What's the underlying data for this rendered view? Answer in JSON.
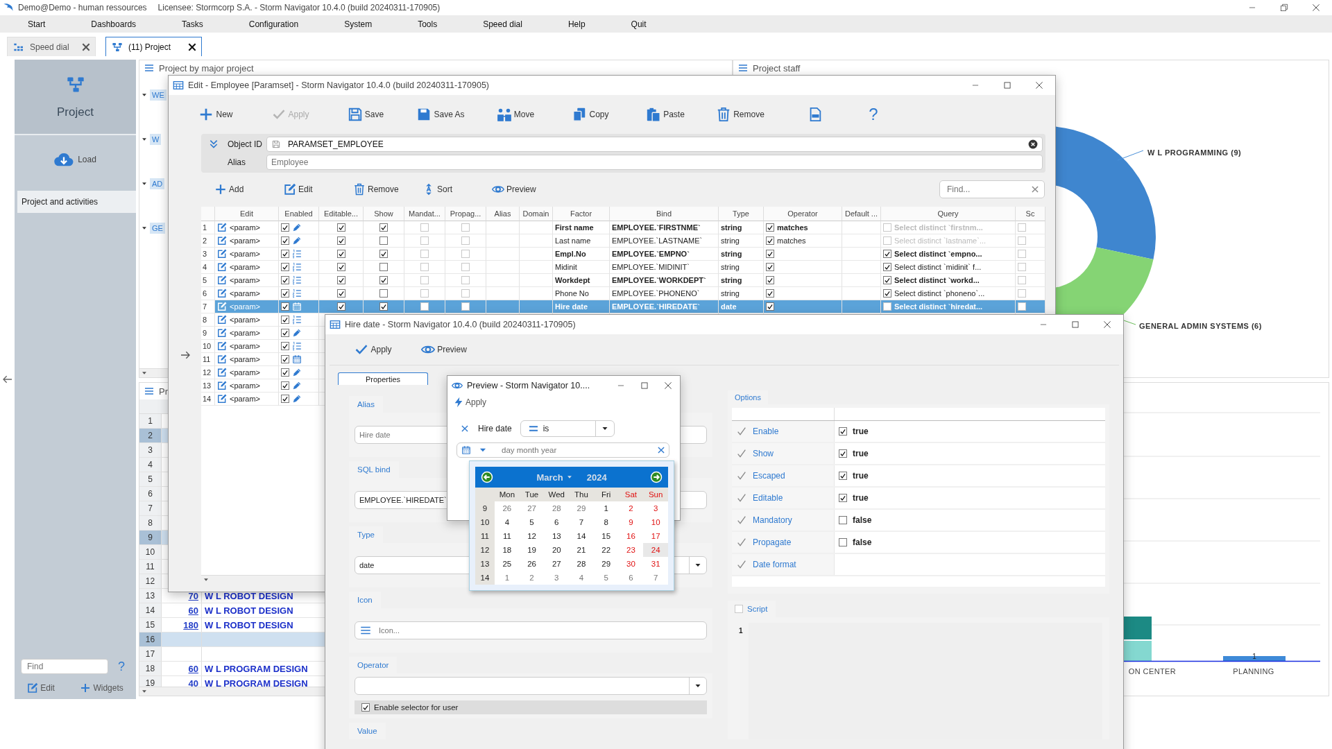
{
  "app_window": {
    "title": "Demo@Demo - human ressources",
    "subtitle": "Licensee: Stormcorp S.A. -  Storm Navigator 10.4.0 (build 20240311-170905)"
  },
  "menu": [
    "Start",
    "Dashboards",
    "Tasks",
    "Configuration",
    "System",
    "Tools",
    "Speed dial",
    "Help",
    "Quit"
  ],
  "tabs": [
    {
      "label": "Speed dial",
      "selected": false
    },
    {
      "label": "(11) Project",
      "selected": true
    }
  ],
  "sidebar": {
    "title": "Project",
    "load": "Load",
    "items": [
      {
        "label": "Project and activities",
        "selected": true
      }
    ],
    "find_placeholder": "Find",
    "help": "?",
    "edit": "Edit",
    "widgets": "Widgets"
  },
  "tree_panel": {
    "title": "Project by major project",
    "items": [
      "WE",
      "W",
      "AD",
      "GE"
    ]
  },
  "list_panel": {
    "title": "Pr",
    "rows": [
      {
        "n": "1",
        "selected": false
      },
      {
        "n": "2",
        "selected": true
      },
      {
        "n": "3",
        "selected": false
      },
      {
        "n": "4",
        "selected": false
      },
      {
        "n": "5",
        "selected": false
      },
      {
        "n": "6",
        "selected": false
      },
      {
        "n": "7",
        "selected": false
      },
      {
        "n": "8",
        "selected": false
      },
      {
        "n": "9",
        "selected": true
      },
      {
        "n": "10",
        "selected": false
      },
      {
        "n": "11",
        "selected": false
      },
      {
        "n": "12",
        "selected": false
      },
      {
        "n": "13",
        "value": "70",
        "name": "W L ROBOT DESIGN",
        "selected": false
      },
      {
        "n": "14",
        "value": "60",
        "name": "W L ROBOT DESIGN",
        "selected": false
      },
      {
        "n": "15",
        "value": "180",
        "name": "W L ROBOT DESIGN",
        "selected": false
      },
      {
        "n": "16",
        "selected": true
      },
      {
        "n": "17",
        "selected": false
      },
      {
        "n": "18",
        "value": "60",
        "name": "W L PROGRAM DESIGN",
        "selected": false
      },
      {
        "n": "19",
        "value": "40",
        "name": "W L PROGRAM DESIGN",
        "selected": false
      }
    ]
  },
  "staff_panel": {
    "title": "Project staff",
    "labels": [
      "W L PROGRAMMING (9)",
      "GENERAL ADMIN SYSTEMS (6)"
    ]
  },
  "bar_panel": {
    "categories": [
      "ON CENTER",
      "PLANNING"
    ],
    "value_label": "1"
  },
  "edit_window": {
    "title": "Edit - Employee [Paramset] -  Storm Navigator 10.4.0 (build 20240311-170905)",
    "toolbar": [
      {
        "kind": "new",
        "label": "New",
        "disabled": false
      },
      {
        "kind": "apply",
        "label": "Apply",
        "disabled": true
      },
      {
        "kind": "save",
        "label": "Save",
        "disabled": false
      },
      {
        "kind": "save-as",
        "label": "Save As",
        "disabled": false
      },
      {
        "kind": "move",
        "label": "Move",
        "disabled": false
      },
      {
        "kind": "copy",
        "label": "Copy",
        "disabled": false
      },
      {
        "kind": "paste",
        "label": "Paste",
        "disabled": false
      },
      {
        "kind": "remove",
        "label": "Remove",
        "disabled": false
      },
      {
        "kind": "xml",
        "disabled": false
      },
      {
        "kind": "help",
        "label": "?",
        "disabled": false
      }
    ],
    "object_id": {
      "label": "Object ID",
      "value": "PARAMSET_EMPLOYEE"
    },
    "alias": {
      "label": "Alias",
      "placeholder": "Employee"
    },
    "list_toolbar": [
      {
        "kind": "add",
        "label": "Add"
      },
      {
        "kind": "edit",
        "label": "Edit"
      },
      {
        "kind": "remove",
        "label": "Remove"
      },
      {
        "kind": "sort",
        "label": "Sort"
      },
      {
        "kind": "preview",
        "label": "Preview"
      }
    ],
    "find_placeholder": "Find...",
    "columns": [
      "Edit",
      "Enabled",
      "Editable...",
      "Show",
      "Mandat...",
      "Propag...",
      "Alias",
      "Domain",
      "Factor",
      "Bind",
      "Type",
      "Operator",
      "Default ...",
      "Query",
      "Sc"
    ],
    "rows": [
      {
        "n": "1",
        "edit": "<param>",
        "enabled": true,
        "kind": "pencil",
        "editable": true,
        "show": true,
        "mandatory": false,
        "propagate": false,
        "factor": "First name",
        "bind": "EMPLOYEE.`FIRSTNME`",
        "type": "string",
        "operator_on": true,
        "operator": "matches",
        "query_on": false,
        "query": "Select distinct `firstnm...",
        "sc": false,
        "selected": false
      },
      {
        "n": "2",
        "edit": "<param>",
        "enabled": true,
        "kind": "pencil",
        "editable": true,
        "show": false,
        "mandatory": false,
        "propagate": false,
        "factor": "Last name",
        "bind": "EMPLOYEE.`LASTNAME`",
        "type": "string",
        "operator_on": true,
        "operator": "matches",
        "query_on": false,
        "query": "Select distinct `lastname`...",
        "sc": false,
        "selected": false
      },
      {
        "n": "3",
        "edit": "<param>",
        "enabled": true,
        "kind": "list",
        "editable": true,
        "show": true,
        "mandatory": false,
        "propagate": false,
        "factor": "Empl.No",
        "bind": "EMPLOYEE.`EMPNO`",
        "type": "string",
        "operator_on": true,
        "query_on": true,
        "query": "Select distinct `empno...",
        "sc": false,
        "selected": false
      },
      {
        "n": "4",
        "edit": "<param>",
        "enabled": true,
        "kind": "list",
        "editable": true,
        "show": false,
        "mandatory": false,
        "propagate": false,
        "factor": "Midinit",
        "bind": "EMPLOYEE.`MIDINIT`",
        "type": "string",
        "operator_on": true,
        "query_on": true,
        "query": "Select distinct `midinit` f...",
        "sc": false,
        "selected": false
      },
      {
        "n": "5",
        "edit": "<param>",
        "enabled": true,
        "kind": "list",
        "editable": true,
        "show": true,
        "mandatory": false,
        "propagate": false,
        "factor": "Workdept",
        "bind": "EMPLOYEE.`WORKDEPT`",
        "type": "string",
        "operator_on": true,
        "query_on": true,
        "query": "Select distinct `workd...",
        "sc": false,
        "selected": false
      },
      {
        "n": "6",
        "edit": "<param>",
        "enabled": true,
        "kind": "list",
        "editable": true,
        "show": false,
        "mandatory": false,
        "propagate": false,
        "factor": "Phone No",
        "bind": "EMPLOYEE.`PHONENO`",
        "type": "string",
        "operator_on": true,
        "query_on": true,
        "query": "Select distinct `phoneno`...",
        "sc": false,
        "selected": false
      },
      {
        "n": "7",
        "edit": "<param>",
        "enabled": true,
        "kind": "calendar",
        "editable": true,
        "show": true,
        "mandatory": false,
        "propagate": false,
        "factor": "Hire date",
        "bind": "EMPLOYEE.`HIREDATE`",
        "type": "date",
        "operator_on": true,
        "query_on": false,
        "query": "Select distinct `hiredat...",
        "sc": false,
        "selected": true
      },
      {
        "n": "8",
        "edit": "<param>",
        "enabled": true,
        "kind": "list",
        "selected": false
      },
      {
        "n": "9",
        "edit": "<param>",
        "enabled": true,
        "kind": "pencil",
        "selected": false
      },
      {
        "n": "10",
        "edit": "<param>",
        "enabled": true,
        "kind": "list",
        "selected": false
      },
      {
        "n": "11",
        "edit": "<param>",
        "enabled": true,
        "kind": "calendar",
        "selected": false
      },
      {
        "n": "12",
        "edit": "<param>",
        "enabled": true,
        "kind": "pencil",
        "selected": false
      },
      {
        "n": "13",
        "edit": "<param>",
        "enabled": true,
        "kind": "pencil",
        "selected": false
      },
      {
        "n": "14",
        "edit": "<param>",
        "enabled": true,
        "kind": "pencil",
        "selected": false
      }
    ]
  },
  "hire_window": {
    "title": "Hire date -  Storm Navigator 10.4.0 (build 20240311-170905)",
    "toolbar": [
      {
        "kind": "apply",
        "label": "Apply"
      },
      {
        "kind": "preview",
        "label": "Preview"
      }
    ],
    "tabs": [
      {
        "label": "Properties",
        "selected": true
      }
    ],
    "fields": [
      {
        "label": "Alias",
        "kind": "text",
        "placeholder": "Hire date"
      },
      {
        "label": "SQL bind",
        "kind": "text",
        "value": "EMPLOYEE.`HIREDATE`"
      },
      {
        "label": "Type",
        "kind": "select",
        "value": "date"
      },
      {
        "label": "Icon",
        "kind": "icon",
        "placeholder": "Icon..."
      },
      {
        "label": "Operator",
        "kind": "select"
      }
    ],
    "enable_selector": {
      "label": "Enable selector for user",
      "checked": true
    },
    "value_label": "Value",
    "options": {
      "title": "Options",
      "rows": [
        {
          "label": "Enable",
          "kind": "bool",
          "checked": true,
          "value": "true"
        },
        {
          "label": "Show",
          "kind": "bool",
          "checked": true,
          "value": "true"
        },
        {
          "label": "Escaped",
          "kind": "bool",
          "checked": true,
          "value": "true"
        },
        {
          "label": "Editable",
          "kind": "bool",
          "checked": true,
          "value": "true"
        },
        {
          "label": "Mandatory",
          "kind": "bool",
          "checked": false,
          "value": "false"
        },
        {
          "label": "Propagate",
          "kind": "bool",
          "checked": false,
          "value": "false"
        },
        {
          "label": "Date format",
          "kind": "text"
        }
      ]
    },
    "script": {
      "label": "Script",
      "checked": false,
      "lines": [
        "1"
      ]
    }
  },
  "preview_window": {
    "title": "Preview -  Storm Navigator 10....",
    "apply": "Apply",
    "filter_label": "Hire date",
    "operator": "is",
    "date_placeholder": "day month year"
  },
  "calendar": {
    "month": "March",
    "year": "2024",
    "weekdays": [
      "Mon",
      "Tue",
      "Wed",
      "Thu",
      "Fri",
      "Sat",
      "Sun"
    ],
    "weeks": [
      {
        "week": "9",
        "days": [
          {
            "day": "26",
            "muted": true,
            "selected": false
          },
          {
            "day": "27",
            "muted": true,
            "selected": false
          },
          {
            "day": "28",
            "muted": true,
            "selected": false
          },
          {
            "day": "29",
            "muted": true,
            "selected": false
          },
          {
            "day": "1",
            "muted": false,
            "selected": false
          },
          {
            "day": "2",
            "muted": false,
            "selected": false
          },
          {
            "day": "3",
            "muted": false,
            "selected": false
          }
        ]
      },
      {
        "week": "10",
        "days": [
          {
            "day": "4",
            "muted": false,
            "selected": false
          },
          {
            "day": "5",
            "muted": false,
            "selected": false
          },
          {
            "day": "6",
            "muted": false,
            "selected": false
          },
          {
            "day": "7",
            "muted": false,
            "selected": false
          },
          {
            "day": "8",
            "muted": false,
            "selected": false
          },
          {
            "day": "9",
            "muted": false,
            "selected": false
          },
          {
            "day": "10",
            "muted": false,
            "selected": false
          }
        ]
      },
      {
        "week": "11",
        "days": [
          {
            "day": "11",
            "muted": false,
            "selected": false
          },
          {
            "day": "12",
            "muted": false,
            "selected": false
          },
          {
            "day": "13",
            "muted": false,
            "selected": false
          },
          {
            "day": "14",
            "muted": false,
            "selected": false
          },
          {
            "day": "15",
            "muted": false,
            "selected": false
          },
          {
            "day": "16",
            "muted": false,
            "selected": false
          },
          {
            "day": "17",
            "muted": false,
            "selected": false
          }
        ]
      },
      {
        "week": "12",
        "days": [
          {
            "day": "18",
            "muted": false,
            "selected": false
          },
          {
            "day": "19",
            "muted": false,
            "selected": false
          },
          {
            "day": "20",
            "muted": false,
            "selected": false
          },
          {
            "day": "21",
            "muted": false,
            "selected": false
          },
          {
            "day": "22",
            "muted": false,
            "selected": false
          },
          {
            "day": "23",
            "muted": false,
            "selected": false
          },
          {
            "day": "24",
            "muted": false,
            "selected": true
          }
        ]
      },
      {
        "week": "13",
        "days": [
          {
            "day": "25",
            "muted": false,
            "selected": false
          },
          {
            "day": "26",
            "muted": false,
            "selected": false
          },
          {
            "day": "27",
            "muted": false,
            "selected": false
          },
          {
            "day": "28",
            "muted": false,
            "selected": false
          },
          {
            "day": "29",
            "muted": false,
            "selected": false
          },
          {
            "day": "30",
            "muted": false,
            "selected": false
          },
          {
            "day": "31",
            "muted": false,
            "selected": false
          }
        ]
      },
      {
        "week": "14",
        "days": [
          {
            "day": "1",
            "muted": true,
            "selected": false
          },
          {
            "day": "2",
            "muted": true,
            "selected": false
          },
          {
            "day": "3",
            "muted": true,
            "selected": false
          },
          {
            "day": "4",
            "muted": true,
            "selected": false
          },
          {
            "day": "5",
            "muted": true,
            "selected": false
          },
          {
            "day": "6",
            "muted": true,
            "selected": false
          },
          {
            "day": "7",
            "muted": true,
            "selected": false
          }
        ]
      }
    ]
  }
}
